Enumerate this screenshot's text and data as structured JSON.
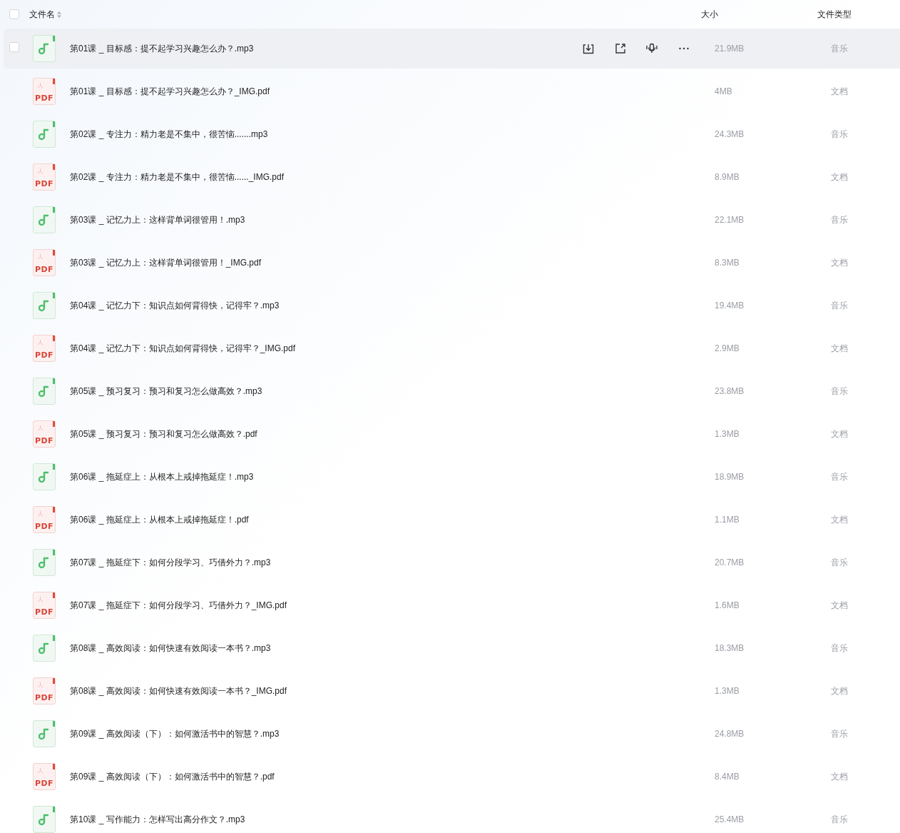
{
  "header": {
    "select_all": {
      "checked": false
    },
    "columns": [
      {
        "label": "文件名",
        "sortable": true
      },
      {
        "label": "大小",
        "sortable": false
      },
      {
        "label": "文件类型",
        "sortable": false
      }
    ]
  },
  "rows": [
    {
      "kind": "audio",
      "name": "第01课 _ 目标感：提不起学习兴趣怎么办？.mp3",
      "size": "21.9MB",
      "type": "音乐",
      "highlighted": true
    },
    {
      "kind": "pdf",
      "badge": "PDF",
      "name": "第01课 _ 目标感：提不起学习兴趣怎么办？_IMG.pdf",
      "size": "4MB",
      "type": "文档",
      "highlighted": false
    },
    {
      "kind": "audio",
      "name": "第02课 _ 专注力：精力老是不集中，很苦恼.......mp3",
      "size": "24.3MB",
      "type": "音乐",
      "highlighted": false
    },
    {
      "kind": "pdf",
      "badge": "PDF",
      "name": "第02课 _ 专注力：精力老是不集中，很苦恼......_IMG.pdf",
      "size": "8.9MB",
      "type": "文档",
      "highlighted": false
    },
    {
      "kind": "audio",
      "name": "第03课 _ 记忆力上：这样背单词很管用！.mp3",
      "size": "22.1MB",
      "type": "音乐",
      "highlighted": false
    },
    {
      "kind": "pdf",
      "badge": "PDF",
      "name": "第03课 _ 记忆力上：这样背单词很管用！_IMG.pdf",
      "size": "8.3MB",
      "type": "文档",
      "highlighted": false
    },
    {
      "kind": "audio",
      "name": "第04课 _ 记忆力下：知识点如何背得快，记得牢？.mp3",
      "size": "19.4MB",
      "type": "音乐",
      "highlighted": false
    },
    {
      "kind": "pdf",
      "badge": "PDF",
      "name": "第04课 _ 记忆力下：知识点如何背得快，记得牢？_IMG.pdf",
      "size": "2.9MB",
      "type": "文档",
      "highlighted": false
    },
    {
      "kind": "audio",
      "name": "第05课 _ 预习复习：预习和复习怎么做高效？.mp3",
      "size": "23.8MB",
      "type": "音乐",
      "highlighted": false
    },
    {
      "kind": "pdf",
      "badge": "PDF",
      "name": "第05课 _ 预习复习：预习和复习怎么做高效？.pdf",
      "size": "1.3MB",
      "type": "文档",
      "highlighted": false
    },
    {
      "kind": "audio",
      "name": "第06课 _ 拖延症上：从根本上戒掉拖延症！.mp3",
      "size": "18.9MB",
      "type": "音乐",
      "highlighted": false
    },
    {
      "kind": "pdf",
      "badge": "PDF",
      "name": "第06课 _ 拖延症上：从根本上戒掉拖延症！.pdf",
      "size": "1.1MB",
      "type": "文档",
      "highlighted": false
    },
    {
      "kind": "audio",
      "name": "第07课 _ 拖延症下：如何分段学习、巧借外力？.mp3",
      "size": "20.7MB",
      "type": "音乐",
      "highlighted": false
    },
    {
      "kind": "pdf",
      "badge": "PDF",
      "name": "第07课 _ 拖延症下：如何分段学习、巧借外力？_IMG.pdf",
      "size": "1.6MB",
      "type": "文档",
      "highlighted": false
    },
    {
      "kind": "audio",
      "name": "第08课 _ 高效阅读：如何快速有效阅读一本书？.mp3",
      "size": "18.3MB",
      "type": "音乐",
      "highlighted": false
    },
    {
      "kind": "pdf",
      "badge": "PDF",
      "name": "第08课 _ 高效阅读：如何快速有效阅读一本书？_IMG.pdf",
      "size": "1.3MB",
      "type": "文档",
      "highlighted": false
    },
    {
      "kind": "audio",
      "name": "第09课 _ 高效阅读（下）：如何激活书中的智慧？.mp3",
      "size": "24.8MB",
      "type": "音乐",
      "highlighted": false
    },
    {
      "kind": "pdf",
      "badge": "PDF",
      "name": "第09课 _ 高效阅读（下）：如何激活书中的智慧？.pdf",
      "size": "8.4MB",
      "type": "文档",
      "highlighted": false
    },
    {
      "kind": "audio",
      "name": "第10课 _ 写作能力：怎样写出高分作文？.mp3",
      "size": "25.4MB",
      "type": "音乐",
      "highlighted": false
    }
  ]
}
